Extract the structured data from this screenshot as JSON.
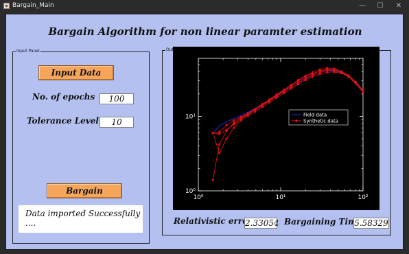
{
  "window": {
    "title": "Bargain_Main"
  },
  "main_title": "Bargain Algorithm for non linear paramter estimation",
  "input_panel": {
    "title": "Input Panel",
    "input_button": "Input Data",
    "epochs_label": "No. of epochs",
    "epochs_value": "100",
    "tolerance_label": "Tolerance Level",
    "tolerance_value": "10",
    "bargain_button": "Bargain",
    "status_text": "Data imported Successfully ...."
  },
  "output_panel": {
    "title": "Output Panel",
    "error_label": "Relativistic error",
    "error_value": "2.33054",
    "time_label": "Bargaining Time",
    "time_value": "5.58329"
  },
  "chart_data": {
    "type": "line",
    "x_scale": "log",
    "y_scale": "log",
    "xlim": [
      1,
      100
    ],
    "ylim": [
      1,
      60
    ],
    "x_ticks": [
      "10⁰",
      "10¹",
      "10²"
    ],
    "y_ticks": [
      "10⁰",
      "10¹"
    ],
    "legend_position": "center-right",
    "colors": {
      "field": "#1e2bd6",
      "synthetic": "#e01010",
      "background": "#000000",
      "axes": "#ffffff"
    },
    "series": [
      {
        "name": "Field data",
        "x": [
          1.5,
          1.8,
          2.2,
          2.7,
          3.3,
          4,
          4.9,
          6,
          7.3,
          8.9,
          11,
          13.4,
          16.3,
          20,
          24.4,
          30,
          36.6,
          44.6,
          54.6,
          66.6,
          81.4,
          100
        ],
        "y": [
          6,
          7.4,
          8.4,
          9.4,
          10.3,
          11.4,
          12.8,
          14.6,
          16.6,
          19,
          21.8,
          25,
          28.6,
          32.5,
          36,
          39,
          41,
          41,
          38.5,
          34,
          28,
          22
        ]
      },
      {
        "name": "Synthetic data",
        "curves": [
          {
            "x": [
              1.5,
              1.8,
              2.2,
              2.7,
              3.3,
              4,
              4.9,
              6,
              7.3,
              8.9,
              11,
              13.4,
              16.3,
              20,
              24.4,
              30,
              36.6,
              44.6,
              54.6,
              66.6,
              81.4,
              100
            ],
            "y": [
              1.4,
              4.2,
              6.4,
              8.2,
              9.6,
              10.8,
              12.2,
              14.0,
              16.2,
              18.6,
              21.6,
              24.8,
              28.4,
              32.0,
              35.6,
              39.0,
              41.5,
              42.0,
              40.0,
              35.5,
              29.0,
              22.5
            ]
          },
          {
            "x": [
              1.5,
              1.8,
              2.2,
              2.7,
              3.3,
              4,
              4.9,
              6,
              7.3,
              8.9,
              11,
              13.4,
              16.3,
              20,
              24.4,
              30,
              36.6,
              44.6,
              54.6,
              66.6,
              81.4,
              100
            ],
            "y": [
              6.0,
              5.8,
              6.6,
              7.8,
              9.2,
              10.6,
              12.2,
              14.2,
              16.6,
              19.2,
              22.4,
              26.0,
              30.0,
              34.0,
              37.5,
              40.5,
              42.5,
              42.0,
              39.0,
              34.0,
              27.5,
              21.5
            ]
          },
          {
            "x": [
              1.5,
              1.8,
              2.2,
              2.7,
              3.3,
              4,
              4.9,
              6,
              7.3,
              8.9,
              11,
              13.4,
              16.3,
              20,
              24.4,
              30,
              36.6,
              44.6,
              54.6,
              66.6,
              81.4,
              100
            ],
            "y": [
              6.0,
              3.2,
              5.0,
              7.0,
              8.8,
              10.2,
              11.6,
              13.4,
              15.4,
              17.8,
              20.6,
              23.6,
              27.0,
              30.6,
              34.0,
              37.0,
              39.0,
              39.5,
              38.0,
              34.0,
              28.5,
              22.5
            ]
          },
          {
            "x": [
              1.5,
              1.8,
              2.2,
              2.7,
              3.3,
              4,
              4.9,
              6,
              7.3,
              8.9,
              11,
              13.4,
              16.3,
              20,
              24.4,
              30,
              36.6,
              44.6,
              54.6,
              66.6,
              81.4,
              100
            ],
            "y": [
              6.0,
              6.2,
              7.6,
              8.8,
              9.8,
              11.0,
              12.6,
              14.6,
              16.8,
              19.6,
              22.8,
              26.4,
              30.6,
              35.0,
              39.0,
              42.5,
              44.5,
              43.5,
              40.0,
              34.5,
              27.5,
              21.0
            ]
          }
        ]
      }
    ]
  }
}
